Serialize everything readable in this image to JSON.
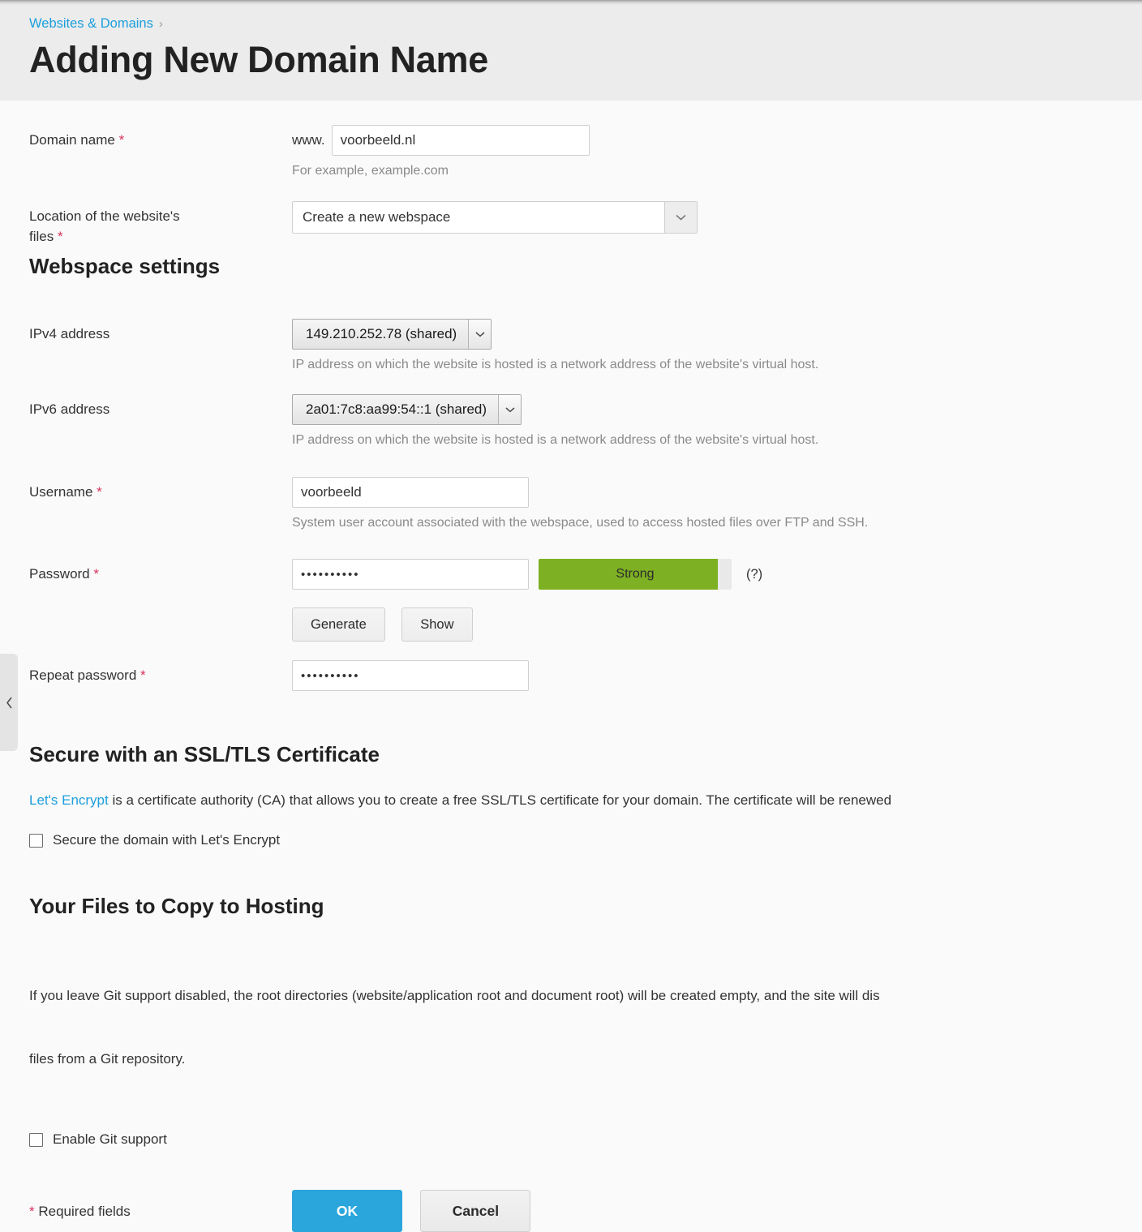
{
  "breadcrumb": {
    "parent": "Websites & Domains",
    "separator": "›"
  },
  "header": {
    "title": "Adding New Domain Name"
  },
  "form": {
    "domain": {
      "label": "Domain name",
      "required_mark": "*",
      "prefix": "www.",
      "value": "voorbeeld.nl",
      "hint": "For example, example.com"
    },
    "location": {
      "label_line1": "Location of the website's",
      "label_line2": "files",
      "required_mark": "*",
      "value": "Create a new webspace"
    },
    "webspace_settings_title": "Webspace settings",
    "ipv4": {
      "label": "IPv4 address",
      "value": "149.210.252.78 (shared)",
      "hint": "IP address on which the website is hosted is a network address of the website's virtual host."
    },
    "ipv6": {
      "label": "IPv6 address",
      "value": "2a01:7c8:aa99:54::1 (shared)",
      "hint": "IP address on which the website is hosted is a network address of the website's virtual host."
    },
    "username": {
      "label": "Username",
      "required_mark": "*",
      "value": "voorbeeld",
      "hint": "System user account associated with the webspace, used to access hosted files over FTP and SSH."
    },
    "password": {
      "label": "Password",
      "required_mark": "*",
      "value": "••••••••••",
      "strength_label": "Strong",
      "strength_color": "#7db022",
      "help_label": "(?)",
      "generate_label": "Generate",
      "show_label": "Show"
    },
    "repeat_password": {
      "label": "Repeat password",
      "required_mark": "*",
      "value": "••••••••••"
    }
  },
  "ssl": {
    "title": "Secure with an SSL/TLS Certificate",
    "link_text": "Let's Encrypt",
    "description": " is a certificate authority (CA) that allows you to create a free SSL/TLS certificate for your domain. The certificate will be renewed",
    "checkbox_label": "Secure the domain with Let's Encrypt"
  },
  "git": {
    "title": "Your Files to Copy to Hosting",
    "description_line1": "If you leave Git support disabled, the root directories (website/application root and document root) will be created empty, and the site will dis",
    "description_line2": "files from a Git repository.",
    "checkbox_label": "Enable Git support"
  },
  "footer": {
    "required_note_mark": "*",
    "required_note": "Required fields",
    "ok_label": "OK",
    "cancel_label": "Cancel"
  },
  "colors": {
    "link": "#1c9fdd",
    "primary": "#2ba6dd",
    "required": "#d8325c",
    "strength_green": "#7db022",
    "header_bg": "#ececec",
    "page_bg": "#fafafa"
  }
}
